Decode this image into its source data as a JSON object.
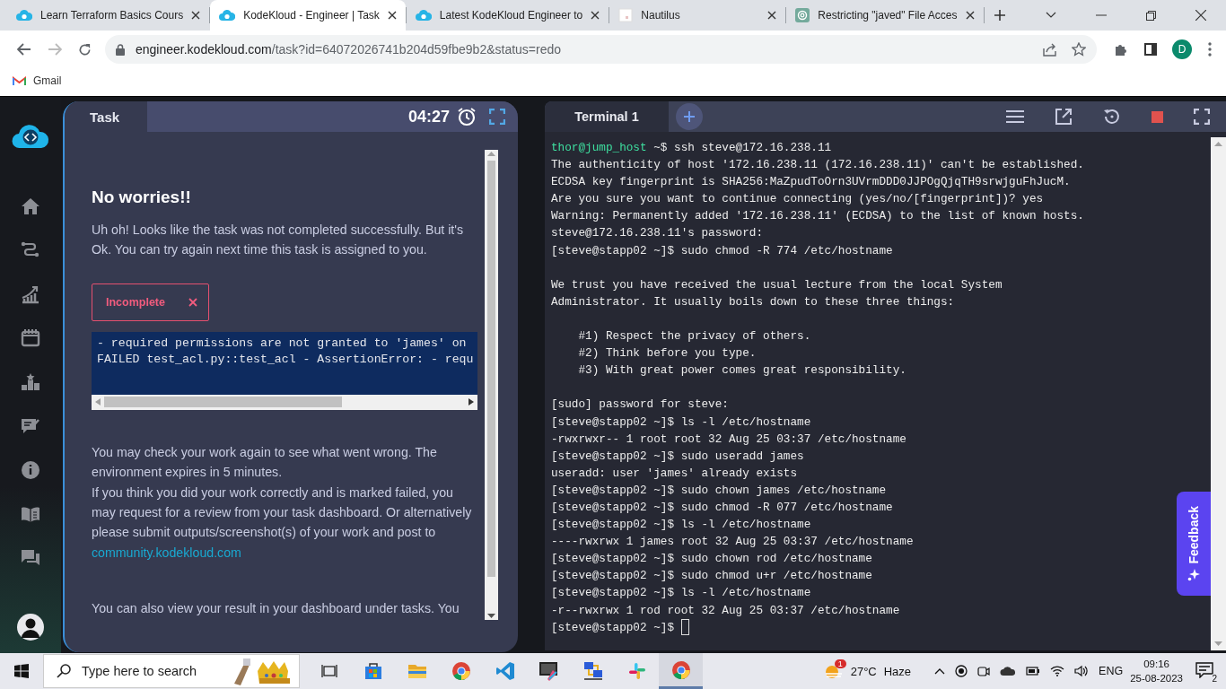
{
  "browser": {
    "tabs": [
      {
        "title": "Learn Terraform Basics Cours",
        "kind": "cloud",
        "selected": false
      },
      {
        "title": "KodeKloud - Engineer | Task",
        "kind": "cloud",
        "selected": true
      },
      {
        "title": "Latest KodeKloud Engineer to",
        "kind": "cloud",
        "selected": false
      },
      {
        "title": "Nautilus",
        "kind": "page",
        "selected": false
      },
      {
        "title": "Restricting \"javed\" File Acces",
        "kind": "knot",
        "selected": false
      }
    ],
    "url_host": "engineer.kodekloud.com",
    "url_path": "/task?id=64072026741b204d59fbe9b2&status=redo",
    "profile": "D",
    "bookmarks": [
      "Gmail"
    ]
  },
  "task_panel": {
    "tab": "Task",
    "timer": "04:27",
    "heading": "No worries!!",
    "intro": "Uh oh! Looks like the task was not completed successfully. But it's Ok. You can try again next time this task is assigned to you.",
    "status": "Incomplete",
    "error_lines": [
      "- required permissions are not granted to 'james' on",
      "FAILED test_acl.py::test_acl - AssertionError: - requ"
    ],
    "paragraph_1": "You may check your work again to see what went wrong. The environment expires in 5 minutes.",
    "paragraph_2": "If you think you did your work correctly and is marked failed, you may request for a review from your task dashboard. Or alternatively please submit outputs/screenshot(s) of your work and post to",
    "link": "community.kodekloud.com",
    "paragraph_3": "You can also view your result in your dashboard under tasks. You"
  },
  "terminal": {
    "tab": "Terminal 1",
    "lines": [
      {
        "kind": "jump",
        "host": "thor@jump_host",
        "text": " ~$ ssh steve@172.16.238.11"
      },
      {
        "kind": "out",
        "text": "The authenticity of host '172.16.238.11 (172.16.238.11)' can't be established."
      },
      {
        "kind": "out",
        "text": "ECDSA key fingerprint is SHA256:MaZpudToOrn3UVrmDDD0JJPOgQjqTH9srwjguFhJucM."
      },
      {
        "kind": "out",
        "text": "Are you sure you want to continue connecting (yes/no/[fingerprint])? yes"
      },
      {
        "kind": "out",
        "text": "Warning: Permanently added '172.16.238.11' (ECDSA) to the list of known hosts."
      },
      {
        "kind": "out",
        "text": "steve@172.16.238.11's password:"
      },
      {
        "kind": "out",
        "text": "[steve@stapp02 ~]$ sudo chmod -R 774 /etc/hostname"
      },
      {
        "kind": "blank"
      },
      {
        "kind": "out",
        "text": "We trust you have received the usual lecture from the local System"
      },
      {
        "kind": "out",
        "text": "Administrator. It usually boils down to these three things:"
      },
      {
        "kind": "blank"
      },
      {
        "kind": "out",
        "text": "    #1) Respect the privacy of others."
      },
      {
        "kind": "out",
        "text": "    #2) Think before you type."
      },
      {
        "kind": "out",
        "text": "    #3) With great power comes great responsibility."
      },
      {
        "kind": "blank"
      },
      {
        "kind": "out",
        "text": "[sudo] password for steve:"
      },
      {
        "kind": "out",
        "text": "[steve@stapp02 ~]$ ls -l /etc/hostname"
      },
      {
        "kind": "out",
        "text": "-rwxrwxr-- 1 root root 32 Aug 25 03:37 /etc/hostname"
      },
      {
        "kind": "out",
        "text": "[steve@stapp02 ~]$ sudo useradd james"
      },
      {
        "kind": "out",
        "text": "useradd: user 'james' already exists"
      },
      {
        "kind": "out",
        "text": "[steve@stapp02 ~]$ sudo chown james /etc/hostname"
      },
      {
        "kind": "out",
        "text": "[steve@stapp02 ~]$ sudo chmod -R 077 /etc/hostname"
      },
      {
        "kind": "out",
        "text": "[steve@stapp02 ~]$ ls -l /etc/hostname"
      },
      {
        "kind": "out",
        "text": "----rwxrwx 1 james root 32 Aug 25 03:37 /etc/hostname"
      },
      {
        "kind": "out",
        "text": "[steve@stapp02 ~]$ sudo chown rod /etc/hostname"
      },
      {
        "kind": "out",
        "text": "[steve@stapp02 ~]$ sudo chmod u+r /etc/hostname"
      },
      {
        "kind": "out",
        "text": "[steve@stapp02 ~]$ ls -l /etc/hostname"
      },
      {
        "kind": "out",
        "text": "-r--rwxrwx 1 rod root 32 Aug 25 03:37 /etc/hostname"
      },
      {
        "kind": "cursor",
        "text": "[steve@stapp02 ~]$"
      }
    ]
  },
  "feedback": "Feedback",
  "taskbar": {
    "search_placeholder": "Type here to search",
    "apps": [
      {
        "kind": "taskview",
        "active": false
      },
      {
        "kind": "store",
        "active": false
      },
      {
        "kind": "folder",
        "active": false
      },
      {
        "kind": "chrome",
        "active": false
      },
      {
        "kind": "vscode",
        "active": false
      },
      {
        "kind": "snip",
        "active": false
      },
      {
        "kind": "network",
        "active": false
      },
      {
        "kind": "slack",
        "active": false
      },
      {
        "kind": "chrome",
        "active": true
      }
    ],
    "weather_badge": "1",
    "temperature": "27°C",
    "weather": "Haze",
    "language": "ENG",
    "time": "09:16",
    "date": "25-08-2023",
    "notifications": "2"
  }
}
